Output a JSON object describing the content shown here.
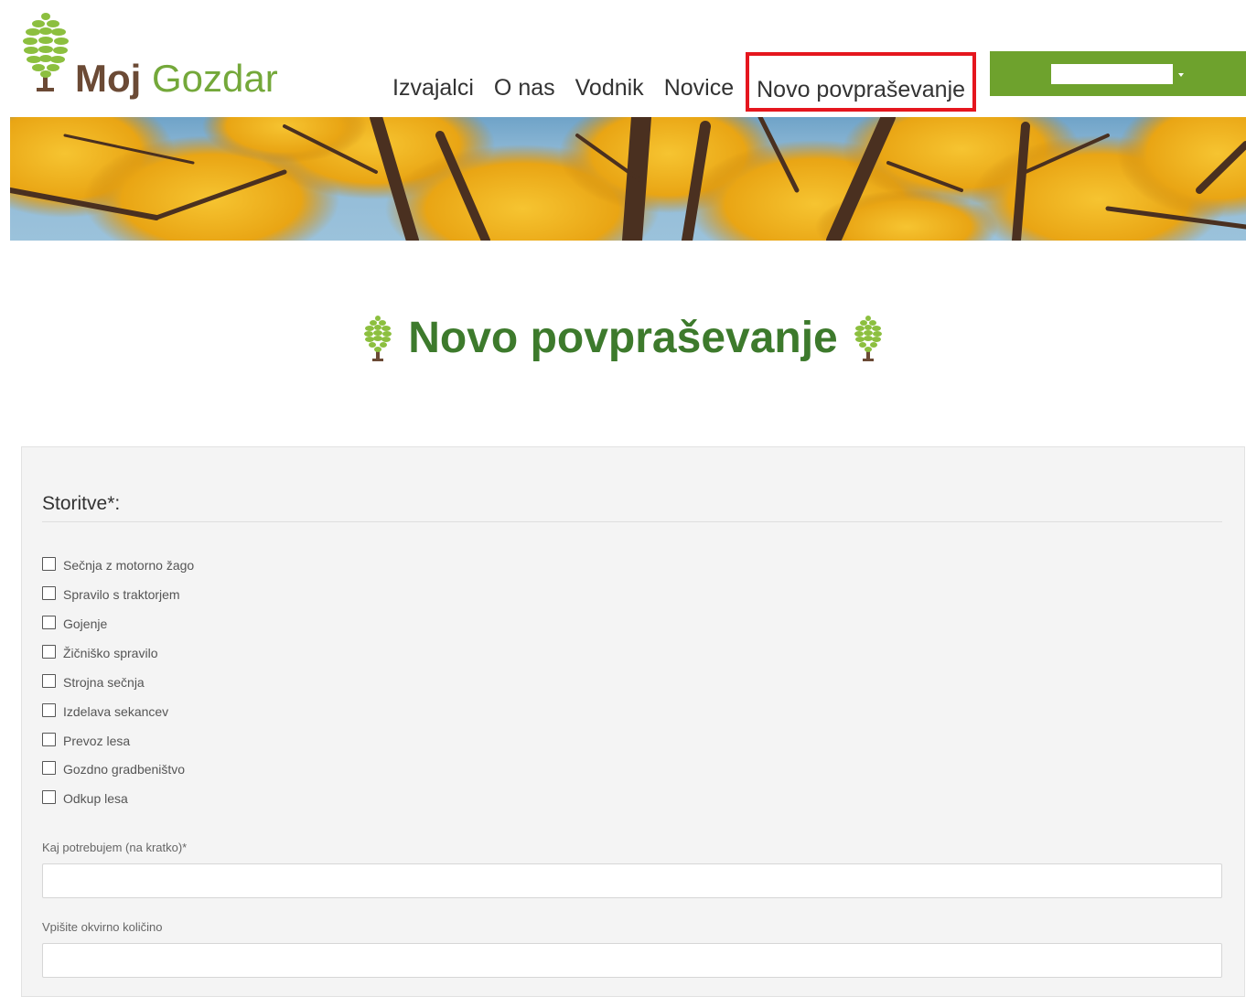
{
  "header": {
    "logo": {
      "word1": "Moj",
      "word2": "Gozdar",
      "icon": "pine-cone-icon"
    },
    "nav": [
      "Izvajalci",
      "O nas",
      "Vodnik",
      "Novice",
      "Novo povpraševanje"
    ],
    "highlighted_nav": "Novo povpraševanje",
    "user_menu": {
      "value": "",
      "icon": "caret-down-icon"
    }
  },
  "banner": {
    "description_icon": "autumn-trees-banner"
  },
  "page": {
    "title": "Novo povpraševanje"
  },
  "form": {
    "services_heading": "Storitve*:",
    "services": [
      "Sečnja z motorno žago",
      "Spravilo s traktorjem",
      "Gojenje",
      "Žičniško spravilo",
      "Strojna sečnja",
      "Izdelava sekancev",
      "Prevoz lesa",
      "Gozdno gradbeništvo",
      "Odkup lesa"
    ],
    "field1_label": "Kaj potrebujem (na kratko)*",
    "field1_value": "",
    "field2_label": "Vpišite okvirno količino",
    "field2_value": ""
  },
  "colors": {
    "brand_green": "#6ea22d",
    "title_green": "#3d7a2c",
    "logo_brown": "#6b4a35",
    "highlight_red": "#e5161e"
  }
}
